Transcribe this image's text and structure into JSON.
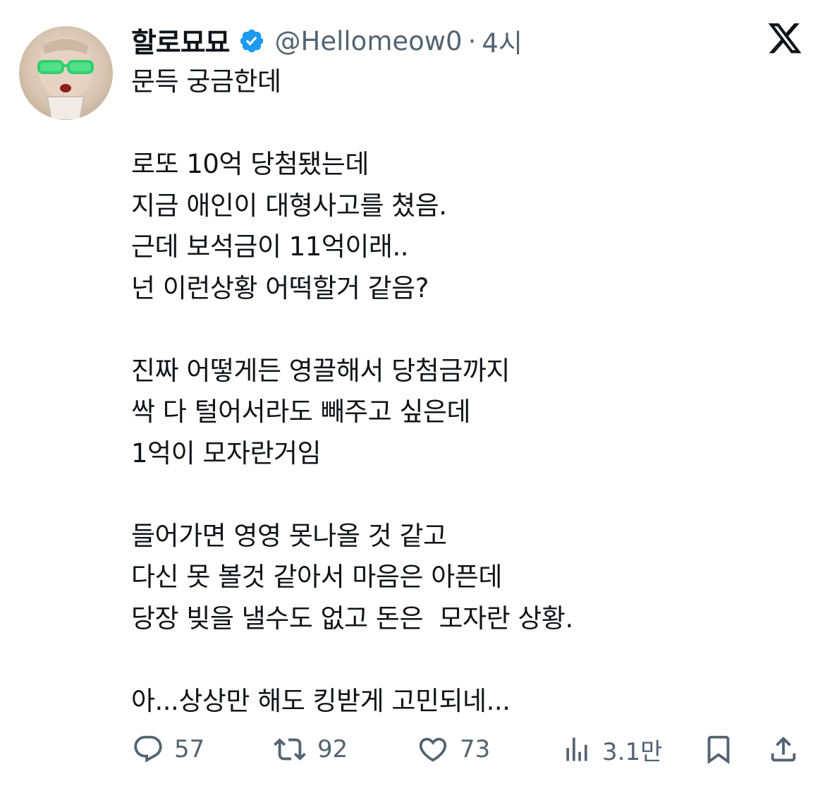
{
  "author": {
    "display_name": "할로묘묘",
    "handle": "@Hellomeow0",
    "separator": "·",
    "time": "4시"
  },
  "tweet": {
    "lines": [
      "문득 궁금한데",
      "",
      "로또 10억 당첨됐는데",
      "지금 애인이 대형사고를 쳤음.",
      "근데 보석금이 11억이래..",
      "넌 이런상황 어떡할거 같음?",
      "",
      "진짜 어떻게든 영끌해서 당첨금까지",
      "싹 다 털어서라도 빼주고 싶은데",
      "1억이 모자란거임",
      "",
      "들어가면 영영 못나올 것 같고",
      "다신 못 볼것 같아서 마음은 아픈데",
      "당장 빚을 낼수도 없고 돈은  모자란 상황.",
      "",
      "아...상상만 해도 킹받게 고민되네..."
    ]
  },
  "actions": {
    "replies": "57",
    "reposts": "92",
    "likes": "73",
    "views": "3.1만"
  },
  "icons": {
    "verified": "verified-badge-icon",
    "logo": "x-logo-icon",
    "reply": "reply-icon",
    "repost": "repost-icon",
    "like": "heart-icon",
    "views": "views-icon",
    "bookmark": "bookmark-icon",
    "share": "share-icon"
  },
  "colors": {
    "text": "#0f1419",
    "secondary": "#536471",
    "verified": "#1d9bf0"
  }
}
